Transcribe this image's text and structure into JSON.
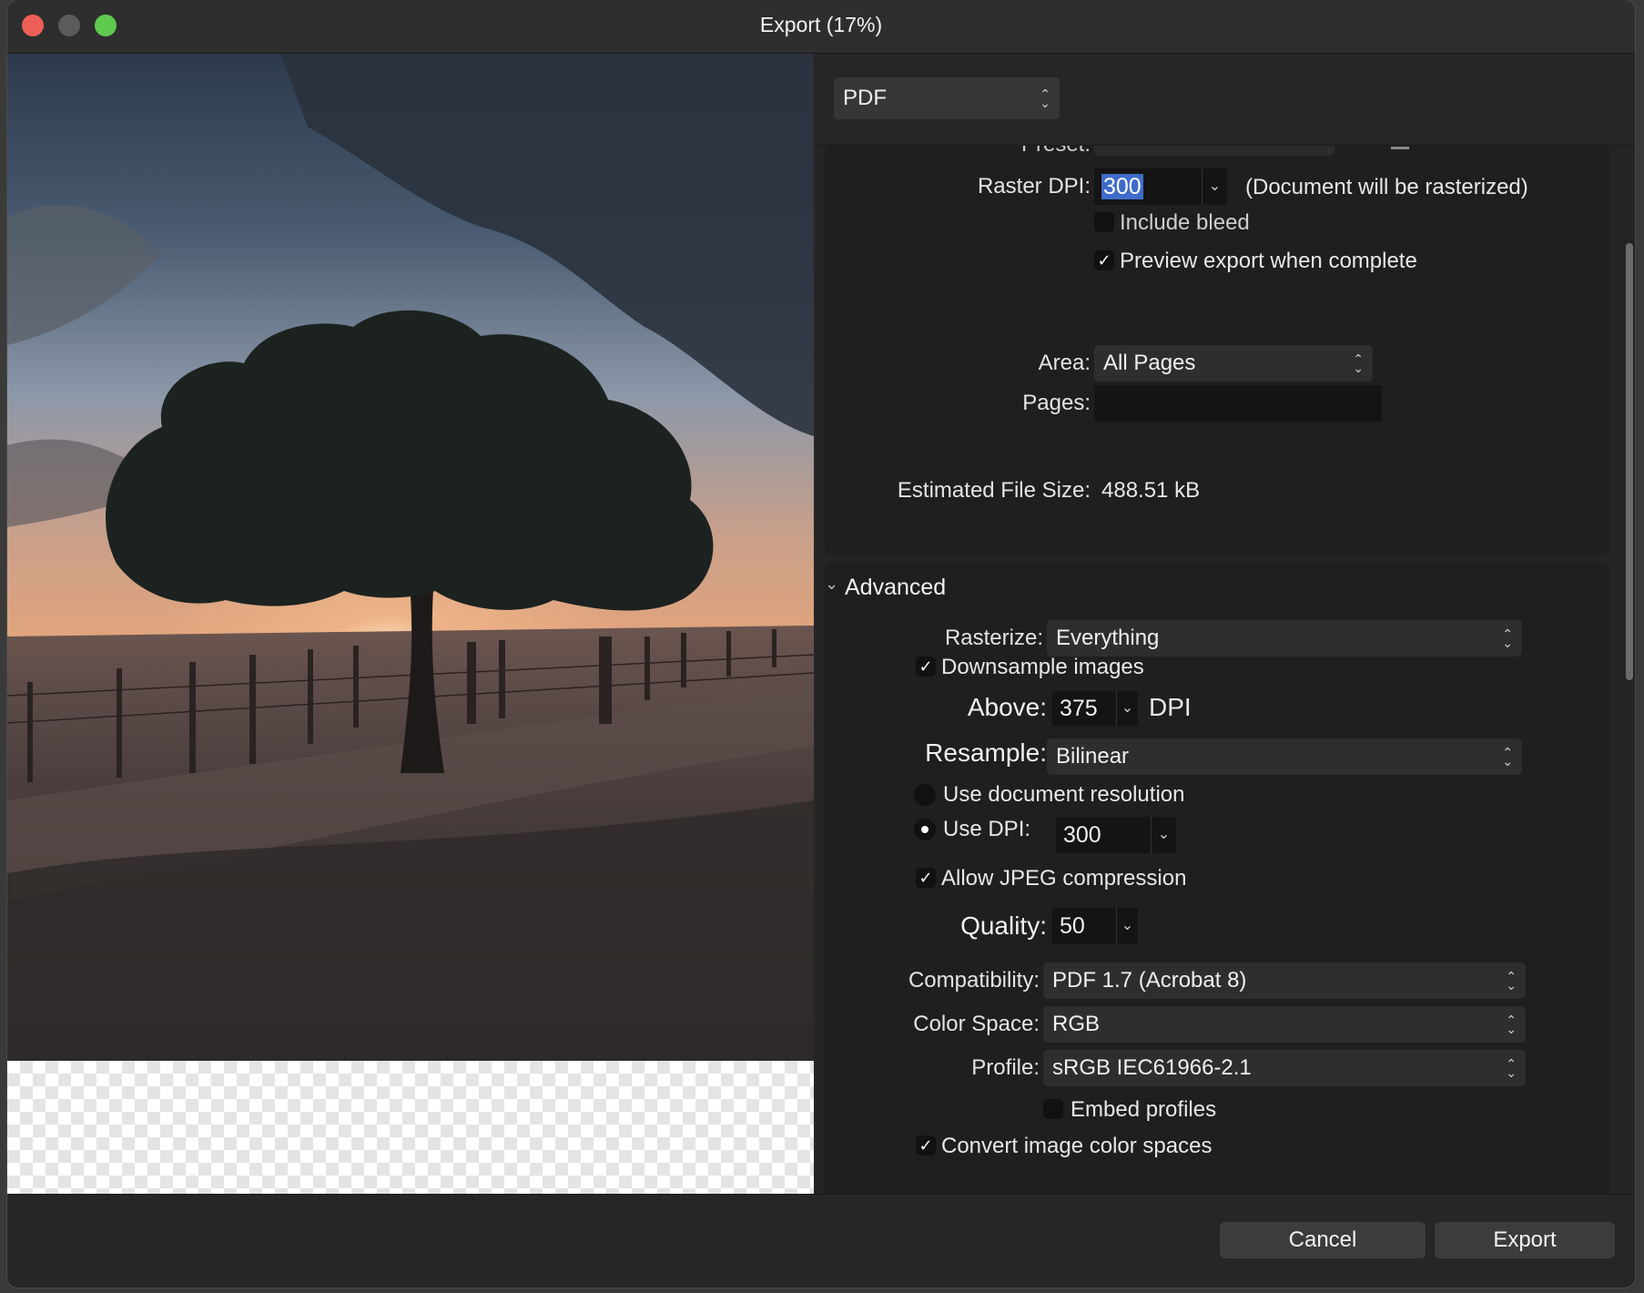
{
  "window": {
    "title": "Export (17%)"
  },
  "format": {
    "value": "PDF"
  },
  "general": {
    "preset_label": "Preset:",
    "raster_dpi_label": "Raster DPI:",
    "raster_dpi_value": "300",
    "raster_note": "(Document will be rasterized)",
    "include_bleed_label": "Include bleed",
    "include_bleed_checked": false,
    "preview_label": "Preview export when complete",
    "preview_checked": true,
    "area_label": "Area:",
    "area_value": "All Pages",
    "pages_label": "Pages:",
    "pages_value": "",
    "est_size_label": "Estimated File Size:",
    "est_size_value": "488.51 kB"
  },
  "advanced": {
    "header": "Advanced",
    "rasterize_label": "Rasterize:",
    "rasterize_value": "Everything",
    "downsample_label": "Downsample images",
    "downsample_checked": true,
    "above_label": "Above:",
    "above_value": "375",
    "above_unit": "DPI",
    "resample_label": "Resample:",
    "resample_value": "Bilinear",
    "use_doc_res_label": "Use document resolution",
    "use_dpi_label": "Use DPI:",
    "use_dpi_value": "300",
    "jpeg_label": "Allow JPEG compression",
    "jpeg_checked": true,
    "quality_label": "Quality:",
    "quality_value": "50",
    "compat_label": "Compatibility:",
    "compat_value": "PDF 1.7 (Acrobat 8)",
    "colorspace_label": "Color Space:",
    "colorspace_value": "RGB",
    "profile_label": "Profile:",
    "profile_value": "sRGB IEC61966-2.1",
    "embed_label": "Embed profiles",
    "embed_checked": false,
    "convert_label": "Convert image color spaces",
    "convert_checked": true
  },
  "footer": {
    "cancel": "Cancel",
    "export": "Export"
  },
  "icons": {
    "checkmark": "✓",
    "chevron_down": "⌄",
    "updown": "⌃⌄",
    "disclosure": "⌵"
  }
}
